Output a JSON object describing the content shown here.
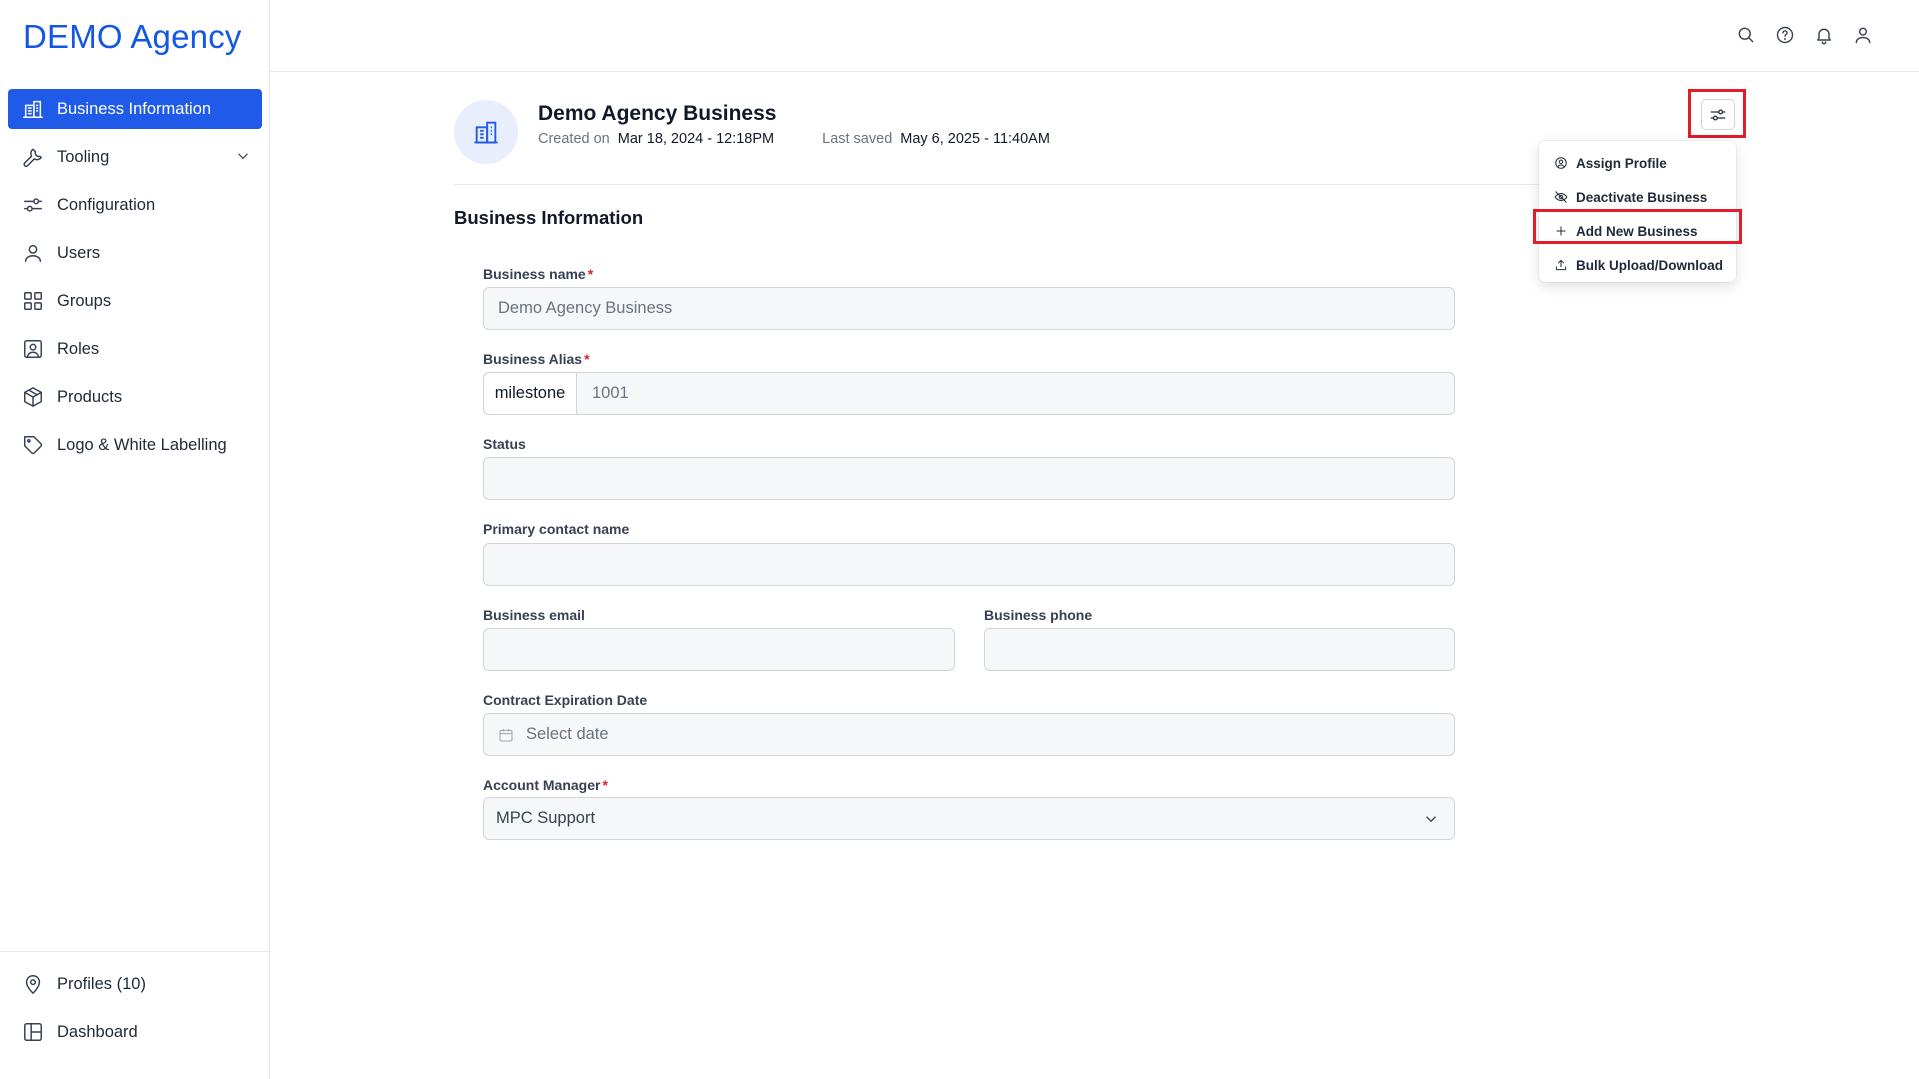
{
  "brand": "DEMO Agency",
  "sidebar": {
    "items": [
      {
        "label": "Business Information",
        "icon": "building-icon"
      },
      {
        "label": "Tooling",
        "icon": "wrench-icon"
      },
      {
        "label": "Configuration",
        "icon": "sliders-icon"
      },
      {
        "label": "Users",
        "icon": "user-icon"
      },
      {
        "label": "Groups",
        "icon": "grid-icon"
      },
      {
        "label": "Roles",
        "icon": "id-badge-icon"
      },
      {
        "label": "Products",
        "icon": "box-icon"
      },
      {
        "label": "Logo & White Labelling",
        "icon": "tag-icon"
      }
    ],
    "bottom_items": [
      {
        "label": "Profiles (10)",
        "icon": "map-pin-icon"
      },
      {
        "label": "Dashboard",
        "icon": "layout-icon"
      }
    ]
  },
  "header": {
    "title": "Demo Agency Business",
    "created_label": "Created on",
    "created_value": "Mar 18, 2024 - 12:18PM",
    "saved_label": "Last saved",
    "saved_value": "May 6, 2025 - 11:40AM"
  },
  "menu": {
    "items": [
      {
        "label": "Assign Profile",
        "icon": "user-circle-icon"
      },
      {
        "label": "Deactivate Business",
        "icon": "eye-off-icon"
      },
      {
        "label": "Add New Business",
        "icon": "plus-icon"
      },
      {
        "label": "Bulk Upload/Download",
        "icon": "upload-icon"
      }
    ]
  },
  "form": {
    "section_title": "Business Information",
    "business_name": {
      "label": "Business name",
      "value": "Demo Agency Business"
    },
    "business_alias": {
      "label": "Business Alias",
      "prefix": "milestone",
      "value": "1001"
    },
    "status": {
      "label": "Status",
      "value": ""
    },
    "primary_contact": {
      "label": "Primary contact name",
      "value": ""
    },
    "business_email": {
      "label": "Business email",
      "value": ""
    },
    "business_phone": {
      "label": "Business phone",
      "value": ""
    },
    "contract_expiration": {
      "label": "Contract Expiration Date",
      "placeholder": "Select date"
    },
    "account_manager": {
      "label": "Account Manager",
      "value": "MPC Support"
    }
  },
  "required_mark": "*",
  "colors": {
    "accent": "#1f5ae8",
    "highlight": "#e11d2a"
  }
}
